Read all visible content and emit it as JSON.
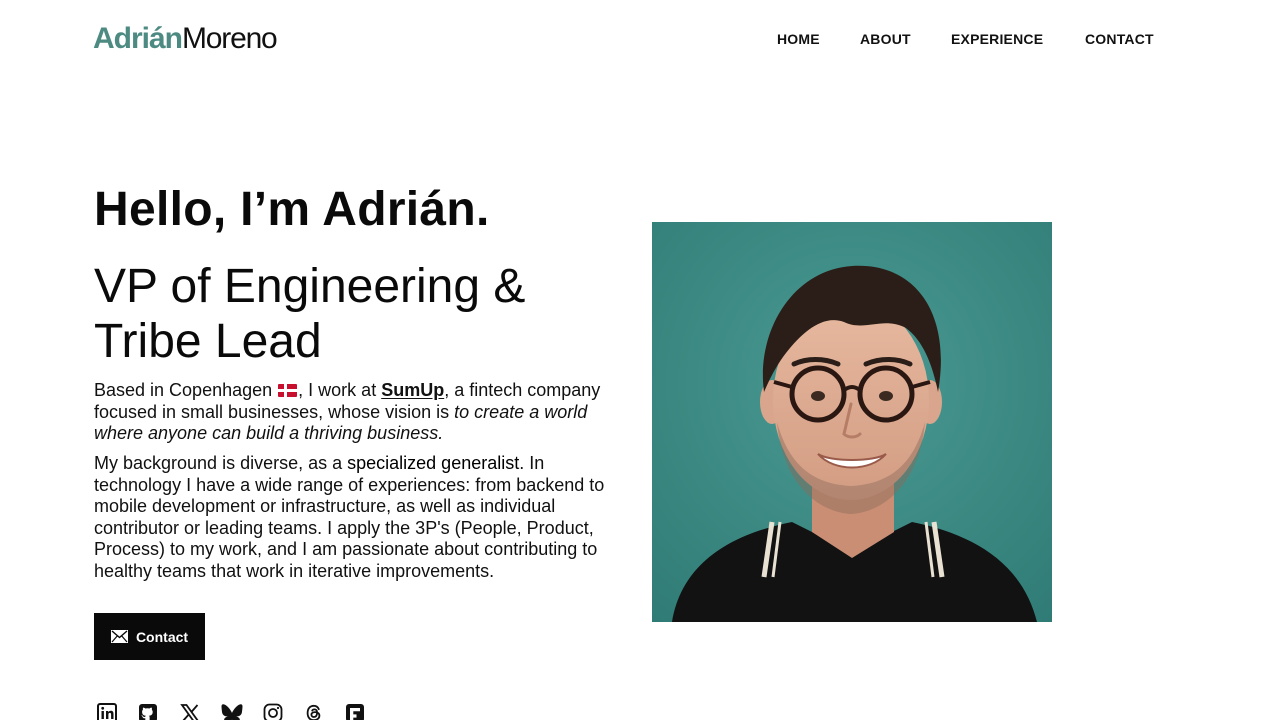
{
  "header": {
    "logo_first": "Adrián",
    "logo_last": "Moreno"
  },
  "nav": {
    "items": [
      "HOME",
      "ABOUT",
      "EXPERIENCE",
      "CONTACT"
    ]
  },
  "hero": {
    "greeting": "Hello, I’m Adrián.",
    "role": "VP of Engineering & Tribe Lead",
    "intro": {
      "prefix": "Based in Copenhagen",
      "middle": ", I work at ",
      "company": "SumUp",
      "after_company": ", a fintech company focused in small businesses, whose vision is ",
      "vision": "to create a world where anyone can build a thriving business."
    },
    "background": {
      "prefix": "My background is diverse, as a ",
      "highlight": "specialized generalist",
      "rest": ". In technology I have a wide range of experiences: from backend to mobile development or infrastructure, as well as individual contributor or leading teams. I apply the 3P's (People, Product, Process) to my work, and I am passionate about contributing to healthy teams that work in iterative improvements."
    },
    "contact_button": "Contact"
  },
  "social_icons": [
    "linkedin-icon",
    "github-icon",
    "x-icon",
    "bluesky-icon",
    "instagram-icon",
    "threads-icon",
    "flipboard-icon"
  ],
  "colors": {
    "brand_teal": "#4d8a82",
    "photo_background": "#3d8b85",
    "button_bg": "#0a0a0a"
  }
}
